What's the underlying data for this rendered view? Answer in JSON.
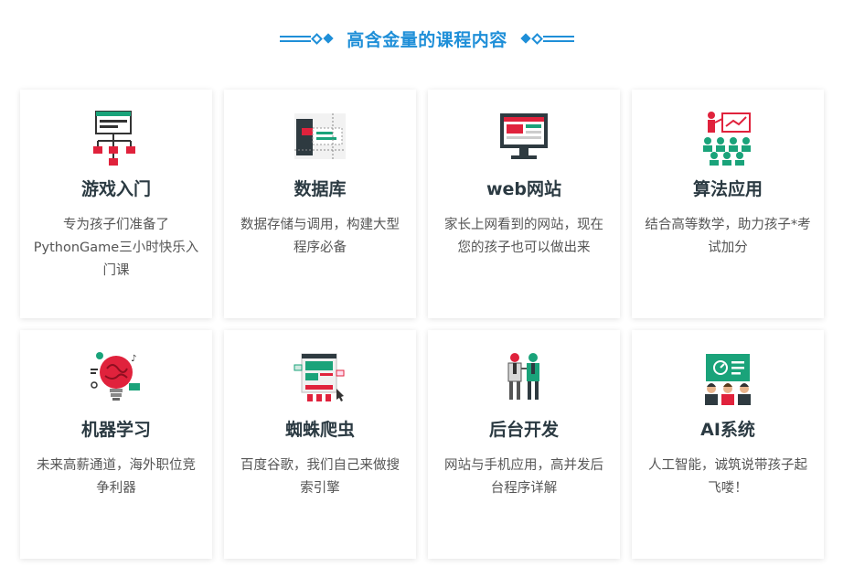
{
  "header": {
    "title": "高含金量的课程内容",
    "accent": "#1f8fd8"
  },
  "courses": [
    {
      "title": "游戏入门",
      "desc": "专为孩子们准备了PythonGame三小时快乐入门课",
      "icon": "game-flowchart-icon"
    },
    {
      "title": "数据库",
      "desc": "数据存储与调用，构建大型程序必备",
      "icon": "database-blueprint-icon"
    },
    {
      "title": "web网站",
      "desc": "家长上网看到的网站，现在您的孩子也可以做出来",
      "icon": "website-monitor-icon"
    },
    {
      "title": "算法应用",
      "desc": "结合高等数学，助力孩子*考试加分",
      "icon": "presentation-classroom-icon"
    },
    {
      "title": "机器学习",
      "desc": "未来高薪通道，海外职位竞争利器",
      "icon": "brain-bulb-icon"
    },
    {
      "title": "蜘蛛爬虫",
      "desc": "百度谷歌，我们自己来做搜索引擎",
      "icon": "web-crawler-icon"
    },
    {
      "title": "后台开发",
      "desc": "网站与手机应用，高并发后台程序详解",
      "icon": "team-developers-icon"
    },
    {
      "title": "AI系统",
      "desc": "人工智能，诚筑说带孩子起飞喽！",
      "icon": "ai-screen-audience-icon"
    }
  ]
}
